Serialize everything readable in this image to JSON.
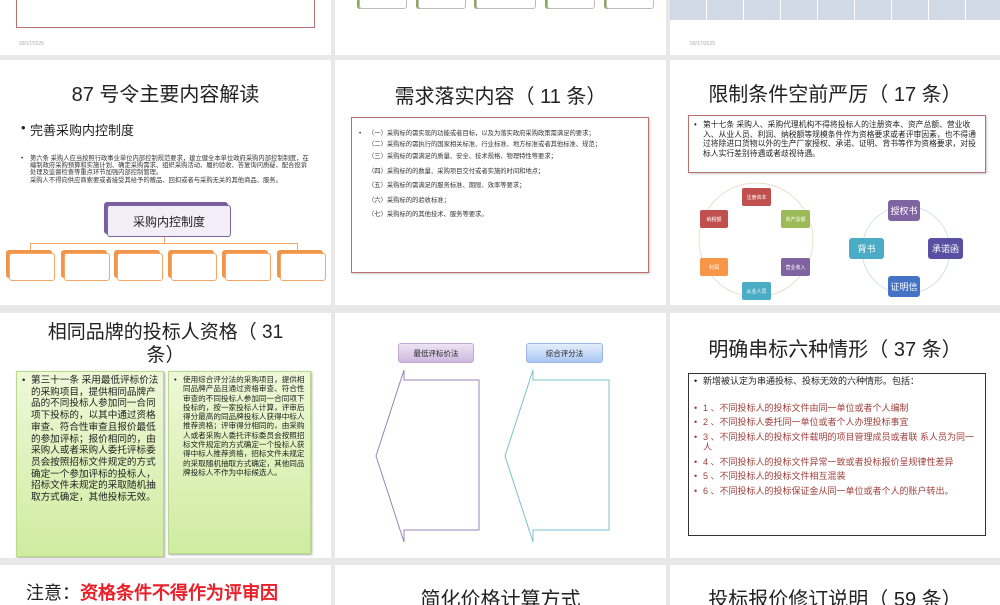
{
  "top_row": {
    "date_left": "09/17/2025",
    "date_right": "09/17/2025"
  },
  "slides": [
    {
      "title": "87 号令主要内容解读",
      "bullet": "完善采购内控制度",
      "body1": "第六条 采购人应当按照行政事业单位内部控制规范要求，建立健全本单位政府采购内部控制制度，在编制政府采购预算和实施计划、确定采购需求、组织采购活动、履约验收、答复询问质疑、配合投诉处理及监督检查等重点环节加强内部控制管理。",
      "body2": "采购人不得向供应商索要或者接受其给予的赠品、回扣或者与采购无关的其他商品、服务。",
      "org_root": "采购内控制度"
    },
    {
      "title": "需求落实内容（ 11 条）",
      "items": [
        "（一）采购标的需实现的功能或者目标，以及为落实政府采购政策需满足的要求；",
        "（二）采购标的需执行的国家相关标准、行业标准、地方标准或者其他标准、规范；",
        "（三）采购标的需满足的质量、安全、技术规格、物理特性等要求；",
        "（四）采购标的的数量、采购项目交付或者实施的时间和地点；",
        "（五）采购标的需满足的服务标准、期限、效率等要求；",
        "（六）采购标的的验收标准；",
        "（七）采购标的的其他技术、服务等要求。"
      ]
    },
    {
      "title": "限制条件空前严厉（ 17 条）",
      "body": "第十七条 采购人、采购代理机构不得将投标人的注册资本、资产总额、营业收入、从业人员、利润、纳税额等规模条件作为资格要求或者评审因素，也不得通过将除进口货物以外的生产厂家授权、承诺、证明、背书等作为资格要求，对投标人实行差别待遇或者歧视待遇。",
      "cycle1": [
        "注册资本",
        "资产总额",
        "营业收入",
        "从业人员",
        "利润",
        "纳税额"
      ],
      "cycle2": [
        "授权书",
        "承诺函",
        "证明信",
        "背书"
      ],
      "colors1": [
        "#c0504d",
        "#9bbb59",
        "#8064a2",
        "#4bacc6",
        "#f79646",
        "#c0504d"
      ],
      "colors2": [
        "#8064a2",
        "#5a4fa3",
        "#4472c4",
        "#4bacc6"
      ]
    },
    {
      "title": "相同品牌的投标人资格（ 31 条）",
      "left": "第三十一条 采用最低评标价法的采购项目，提供相同品牌产品的不同投标人参加同一合同项下投标的，以其中通过资格审查、符合性审查且报价最低的参加评标；报价相同的，由采购人或者采购人委托评标委员会按照招标文件规定的方式确定一个参加评标的投标人，招标文件未规定的采取随机抽取方式确定，其他投标无效。",
      "right": "使用综合评分法的采购项目，提供相同品牌产品且通过资格审查、符合性审查的不同投标人参加同一合同项下投标的，按一家投标人计算，评审后得分最高的同品牌投标人获得中标人推荐资格；评审得分相同的，由采购人或者采购人委托评标委员会按照招标文件规定的方式确定一个投标人获得中标人推荐资格，招标文件未规定的采取随机抽取方式确定，其他同品牌投标人不作为中标候选人。"
    },
    {
      "label1": "最低评标价法",
      "label2": "综合评分法"
    },
    {
      "title": "明确串标六种情形（ 37 条）",
      "intro": "新增被认定为串通投标、投标无效的六种情形。包括：",
      "items": [
        "1 、不同投标人的投标文件由同一单位或者个人编制",
        "2 、不同投标人委托同一单位或者个人办理投标事宜",
        "3 、不同投标人的投标文件载明的项目管理成员或者联  系人员为同一人",
        "4 、不同投标人的投标文件异常一致或者投标报价呈规律性差异",
        "5 、不同投标人的投标文件相互混装",
        "6 、不同投标人的投标保证金从同一单位或者个人的账户转出。"
      ]
    }
  ],
  "bottom_row": {
    "t1_prefix": "注意：",
    "t1_red": "资格条件不得作为评审因",
    "t2": "简化价格计算方式",
    "t3": "投标报价修订说明（ 59 条）"
  }
}
